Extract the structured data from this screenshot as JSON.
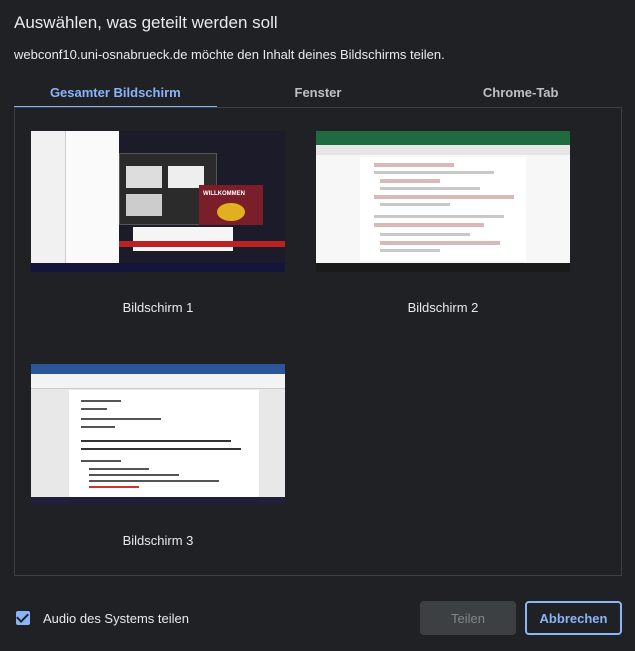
{
  "dialog": {
    "title": "Auswählen, was geteilt werden soll",
    "subtitle": "webconf10.uni-osnabrueck.de möchte den Inhalt deines Bildschirms teilen."
  },
  "tabs": [
    {
      "label": "Gesamter Bildschirm",
      "active": true
    },
    {
      "label": "Fenster",
      "active": false
    },
    {
      "label": "Chrome-Tab",
      "active": false
    }
  ],
  "screens": [
    {
      "label": "Bildschirm 1"
    },
    {
      "label": "Bildschirm 2"
    },
    {
      "label": "Bildschirm 3"
    }
  ],
  "thumbnail_text": {
    "screen1_banner": "WILLKOMMEN"
  },
  "footer": {
    "audio_label": "Audio des Systems teilen",
    "audio_checked": true,
    "share_button": "Teilen",
    "share_enabled": false,
    "cancel_button": "Abbrechen"
  },
  "colors": {
    "background": "#202124",
    "accent": "#8ab4f8",
    "text": "#e8eaed",
    "disabled_button": "#3c4043"
  }
}
